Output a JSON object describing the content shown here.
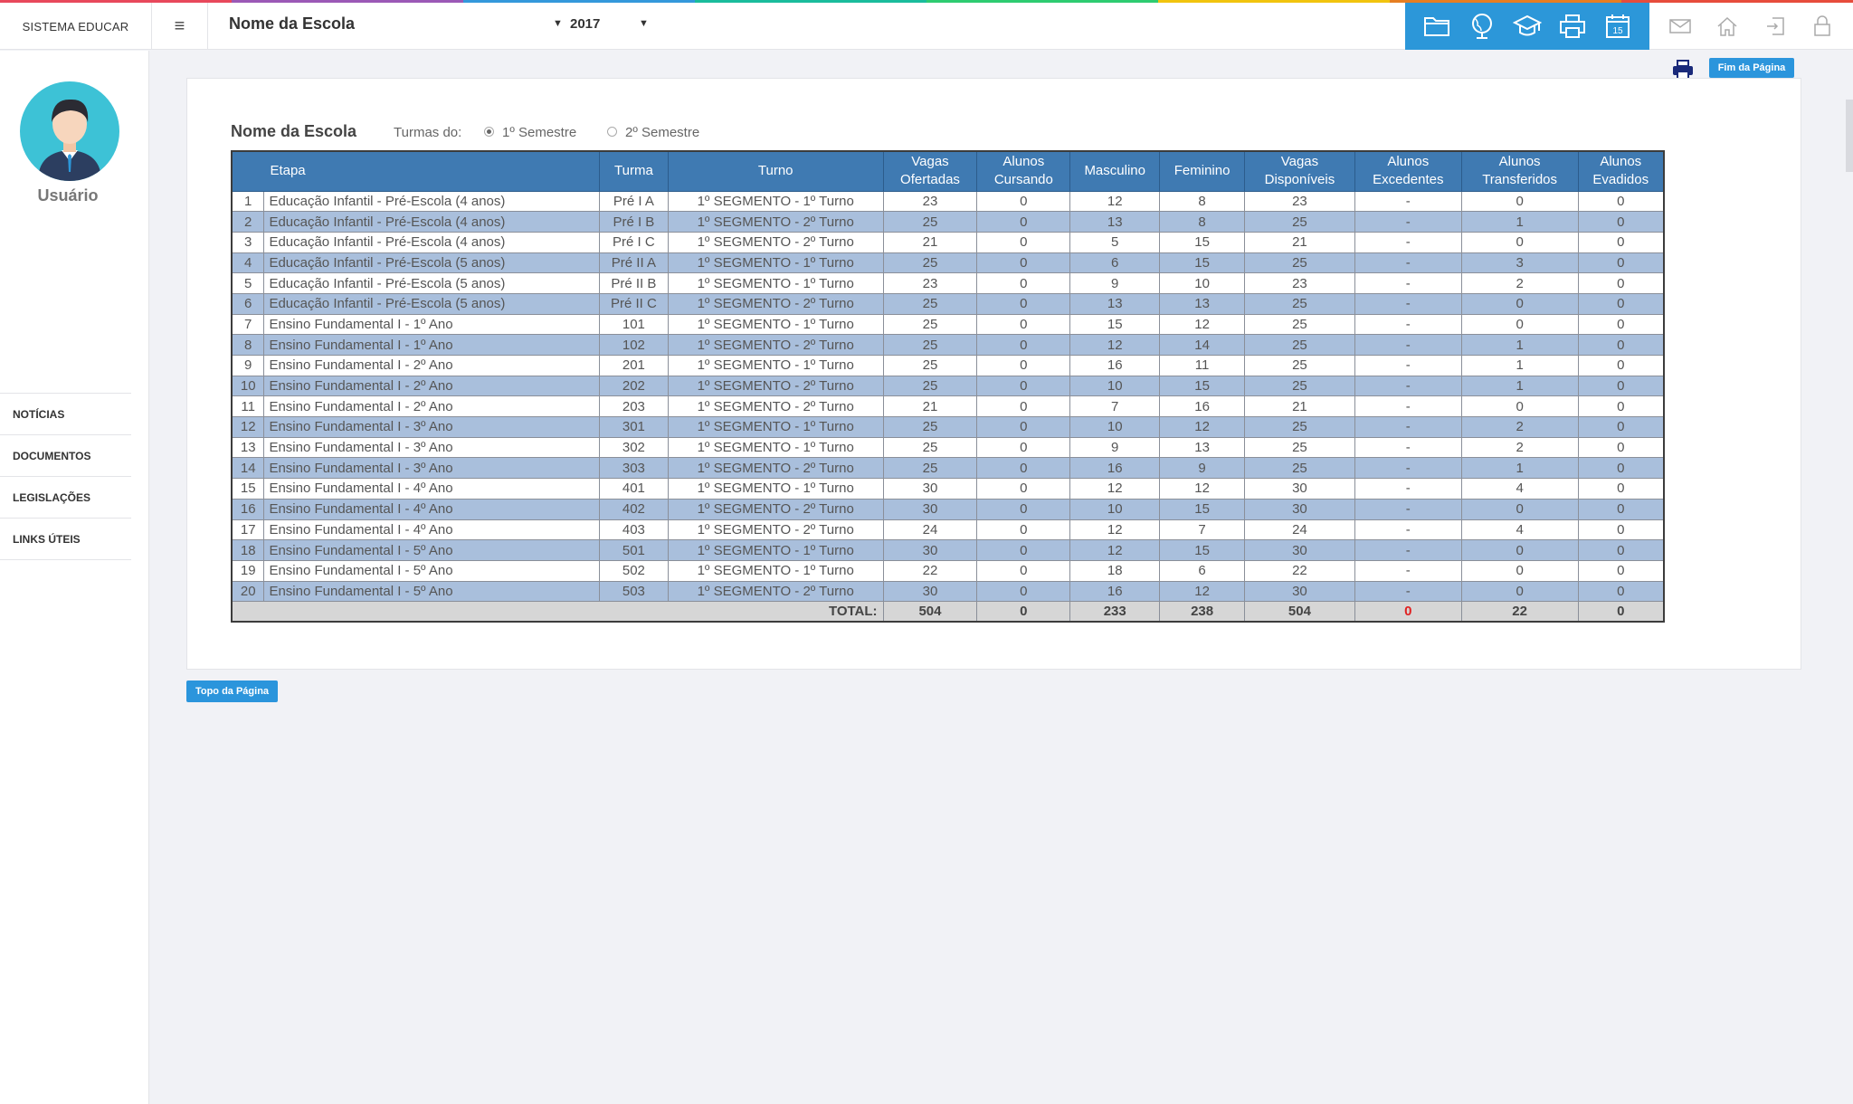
{
  "colors": {
    "accent": "#2c97d9",
    "table_header": "#3f7ab2",
    "row_alt": "#a9bfdc",
    "stripe": [
      "#e8485b",
      "#9b59b6",
      "#3498db",
      "#1abc9c",
      "#2ecc71",
      "#f1c40f",
      "#e67e22",
      "#e74c3c"
    ]
  },
  "header": {
    "brand": "SISTEMA EDUCAR",
    "menu_icon": "≡",
    "school_select": "Nome da Escola",
    "year_select": "2017",
    "caret": "▼",
    "blue_icons": [
      "folder-icon",
      "globe-icon",
      "graduation-cap-icon",
      "printer-icon",
      "calendar-icon"
    ],
    "calendar_day": "15",
    "grey_icons": [
      "mail-icon",
      "home-icon",
      "logout-icon",
      "lock-icon"
    ]
  },
  "sidebar": {
    "user_label": "Usuário",
    "items": [
      {
        "label": "NOTÍCIAS"
      },
      {
        "label": "DOCUMENTOS"
      },
      {
        "label": "LEGISLAÇÕES"
      },
      {
        "label": "LINKS ÚTEIS"
      }
    ]
  },
  "toolbar": {
    "end_button": "Fim da Página",
    "top_button": "Topo da Página"
  },
  "report": {
    "title": "Nome da Escola",
    "turmas_label": "Turmas do:",
    "semester_1": "1º Semestre",
    "semester_2": "2º Semestre",
    "selected_semester": "1º Semestre",
    "columns": [
      {
        "line1": "",
        "line2": ""
      },
      {
        "line1": "Etapa",
        "line2": ""
      },
      {
        "line1": "Turma",
        "line2": ""
      },
      {
        "line1": "Turno",
        "line2": ""
      },
      {
        "line1": "Vagas",
        "line2": "Ofertadas"
      },
      {
        "line1": "Alunos",
        "line2": "Cursando"
      },
      {
        "line1": "Masculino",
        "line2": ""
      },
      {
        "line1": "Feminino",
        "line2": ""
      },
      {
        "line1": "Vagas",
        "line2": "Disponíveis"
      },
      {
        "line1": "Alunos",
        "line2": "Excedentes"
      },
      {
        "line1": "Alunos",
        "line2": "Transferidos"
      },
      {
        "line1": "Alunos",
        "line2": "Evadidos"
      }
    ],
    "rows": [
      [
        "1",
        "Educação Infantil - Pré-Escola (4 anos)",
        "Pré I A",
        "1º SEGMENTO - 1º Turno",
        "23",
        "0",
        "12",
        "8",
        "23",
        "-",
        "0",
        "0"
      ],
      [
        "2",
        "Educação Infantil - Pré-Escola (4 anos)",
        "Pré I B",
        "1º SEGMENTO - 2º Turno",
        "25",
        "0",
        "13",
        "8",
        "25",
        "-",
        "1",
        "0"
      ],
      [
        "3",
        "Educação Infantil - Pré-Escola (4 anos)",
        "Pré I C",
        "1º SEGMENTO - 2º Turno",
        "21",
        "0",
        "5",
        "15",
        "21",
        "-",
        "0",
        "0"
      ],
      [
        "4",
        "Educação Infantil - Pré-Escola (5 anos)",
        "Pré II A",
        "1º SEGMENTO - 1º Turno",
        "25",
        "0",
        "6",
        "15",
        "25",
        "-",
        "3",
        "0"
      ],
      [
        "5",
        "Educação Infantil - Pré-Escola (5 anos)",
        "Pré II B",
        "1º SEGMENTO - 1º Turno",
        "23",
        "0",
        "9",
        "10",
        "23",
        "-",
        "2",
        "0"
      ],
      [
        "6",
        "Educação Infantil - Pré-Escola (5 anos)",
        "Pré II C",
        "1º SEGMENTO - 2º Turno",
        "25",
        "0",
        "13",
        "13",
        "25",
        "-",
        "0",
        "0"
      ],
      [
        "7",
        "Ensino Fundamental I - 1º Ano",
        "101",
        "1º SEGMENTO - 1º Turno",
        "25",
        "0",
        "15",
        "12",
        "25",
        "-",
        "0",
        "0"
      ],
      [
        "8",
        "Ensino Fundamental I - 1º Ano",
        "102",
        "1º SEGMENTO - 2º Turno",
        "25",
        "0",
        "12",
        "14",
        "25",
        "-",
        "1",
        "0"
      ],
      [
        "9",
        "Ensino Fundamental I - 2º Ano",
        "201",
        "1º SEGMENTO - 1º Turno",
        "25",
        "0",
        "16",
        "11",
        "25",
        "-",
        "1",
        "0"
      ],
      [
        "10",
        "Ensino Fundamental I - 2º Ano",
        "202",
        "1º SEGMENTO - 2º Turno",
        "25",
        "0",
        "10",
        "15",
        "25",
        "-",
        "1",
        "0"
      ],
      [
        "11",
        "Ensino Fundamental I - 2º Ano",
        "203",
        "1º SEGMENTO - 2º Turno",
        "21",
        "0",
        "7",
        "16",
        "21",
        "-",
        "0",
        "0"
      ],
      [
        "12",
        "Ensino Fundamental I - 3º Ano",
        "301",
        "1º SEGMENTO - 1º Turno",
        "25",
        "0",
        "10",
        "12",
        "25",
        "-",
        "2",
        "0"
      ],
      [
        "13",
        "Ensino Fundamental I - 3º Ano",
        "302",
        "1º SEGMENTO - 1º Turno",
        "25",
        "0",
        "9",
        "13",
        "25",
        "-",
        "2",
        "0"
      ],
      [
        "14",
        "Ensino Fundamental I - 3º Ano",
        "303",
        "1º SEGMENTO - 2º Turno",
        "25",
        "0",
        "16",
        "9",
        "25",
        "-",
        "1",
        "0"
      ],
      [
        "15",
        "Ensino Fundamental I - 4º Ano",
        "401",
        "1º SEGMENTO - 1º Turno",
        "30",
        "0",
        "12",
        "12",
        "30",
        "-",
        "4",
        "0"
      ],
      [
        "16",
        "Ensino Fundamental I - 4º Ano",
        "402",
        "1º SEGMENTO - 2º Turno",
        "30",
        "0",
        "10",
        "15",
        "30",
        "-",
        "0",
        "0"
      ],
      [
        "17",
        "Ensino Fundamental I - 4º Ano",
        "403",
        "1º SEGMENTO - 2º Turno",
        "24",
        "0",
        "12",
        "7",
        "24",
        "-",
        "4",
        "0"
      ],
      [
        "18",
        "Ensino Fundamental I - 5º Ano",
        "501",
        "1º SEGMENTO - 1º Turno",
        "30",
        "0",
        "12",
        "15",
        "30",
        "-",
        "0",
        "0"
      ],
      [
        "19",
        "Ensino Fundamental I - 5º Ano",
        "502",
        "1º SEGMENTO - 1º Turno",
        "22",
        "0",
        "18",
        "6",
        "22",
        "-",
        "0",
        "0"
      ],
      [
        "20",
        "Ensino Fundamental I - 5º Ano",
        "503",
        "1º SEGMENTO - 2º Turno",
        "30",
        "0",
        "16",
        "12",
        "30",
        "-",
        "0",
        "0"
      ]
    ],
    "total": {
      "label": "TOTAL:",
      "values": [
        "504",
        "0",
        "233",
        "238",
        "504",
        "0",
        "22",
        "0"
      ]
    }
  }
}
